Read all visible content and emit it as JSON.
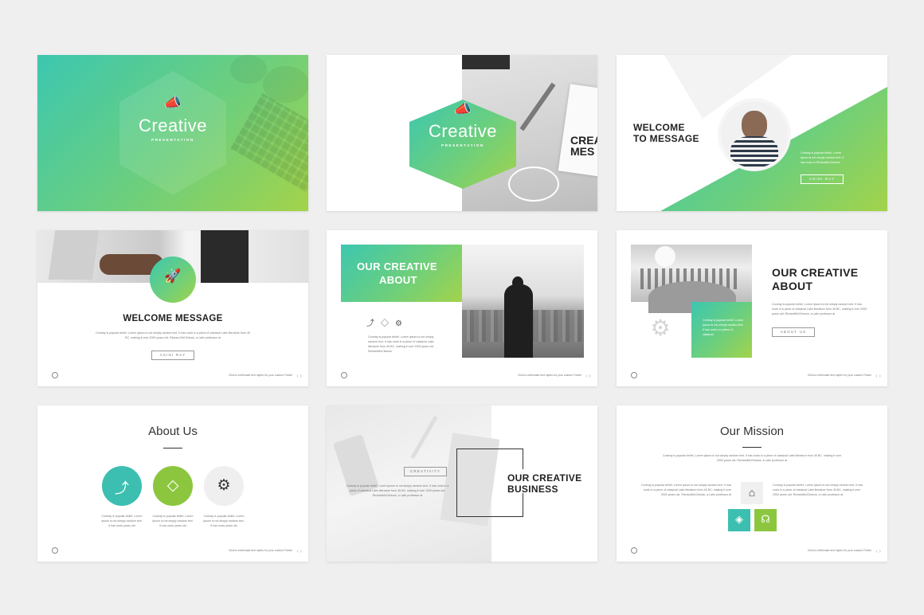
{
  "slides": {
    "s1": {
      "title": "Creative",
      "subtitle": "PRESENTATION"
    },
    "s2": {
      "title": "Creative",
      "subtitle": "PRESENTATION",
      "photo_text": "CREA MES"
    },
    "s3": {
      "title_line1": "WELCOME",
      "title_line2": "TO MESSAGE",
      "body": "Contray is popular belief, Lorem ipsum is not simply random text. It has roots in RichardMcClintock",
      "button": "ASINI RAY"
    },
    "s4": {
      "title": "WELCOME MESSAGE",
      "body": "Contray is popular belief, Lorem ipsum is not simply random text. It has roots in a piece of classical Latin literature from 45 BC, making it over 2000 years old. Richard McClintock, a Latin professor at",
      "button": "ASINI RAY",
      "footer": "Click to edit/make text styles for your custom Folder"
    },
    "s5": {
      "title_line1": "OUR CREATIVE",
      "title_line2": "ABOUT",
      "body": "Contray is popular belief, Lorem ipsum is not simply random text. It has roots in a piece of classical Latin literature from 45 BC, making it over 2000 years old. RichardMcClintock",
      "footer": "Click to edit/make text styles for your custom Folder"
    },
    "s6": {
      "title_line1": "OUR CREATIVE",
      "title_line2": "ABOUT",
      "body": "Contray is popular belief, Lorem ipsum is not simply random text. It has roots in a piece of classical Latin literature from 45 BC, making it over 2000 years old. RichardMcClintock, a Latin professor at",
      "overlay_text": "Contray is popular belief, Lorem ipsum is not simply random text. It has roots in a piece of classical",
      "button": "ABOUT US",
      "footer": "Click to edit/make text styles for your custom Folder"
    },
    "s7": {
      "title": "About Us",
      "items": [
        {
          "text": "Contray is popular belief, Lorem ipsum is not simply random text. It has roots years old",
          "color": "#3cbfb0"
        },
        {
          "text": "Contray is popular belief, Lorem ipsum is not simply random text. It has roots years old",
          "color": "#8cc63f"
        },
        {
          "text": "Contray is popular belief, Lorem ipsum is not simply random text. It has roots years old",
          "color": "#efefef"
        }
      ],
      "footer": "Click to edit/make text styles for your custom Folder"
    },
    "s8": {
      "label": "CREATIVITY",
      "title_line1": "OUR CREATIVE",
      "title_line2": "BUSINESS",
      "body": "Contray is popular belief, Lorem ipsum is not simply random text. It has roots in a piece of classical Latin literature from 45 BC, making it over 2000 years old. RichardMcClintock, a Latin professor at"
    },
    "s9": {
      "title": "Our Mission",
      "intro": "Contray is popular belief, Lorem ipsum is not simply random text. It has roots in a piece of classical Latin literature from 45 BC, making it over 2000 years old. RichardMcClintock, a Latin professor at",
      "left": "Contray is popular belief, Lorem ipsum is not simply random text. It has roots in a piece of classical Latin literature from 45 BC, making it over 2000 years old. RichardMcClintock, a Latin professor at",
      "right": "Contray is popular belief, Lorem ipsum is not simply random text. It has roots in a piece of classical Latin literature from 45 BC, making it over 2000 years old. RichardMcClintock, a Latin professor at",
      "footer": "Click to edit/make text styles for your custom Folder",
      "tile_colors": [
        "#3cbfb0",
        "#8cc63f"
      ]
    }
  },
  "colors": {
    "teal": "#3cc7b0",
    "green": "#a3d34a",
    "background": "#efefef"
  },
  "nav": {
    "prev": "‹",
    "next": "›"
  }
}
